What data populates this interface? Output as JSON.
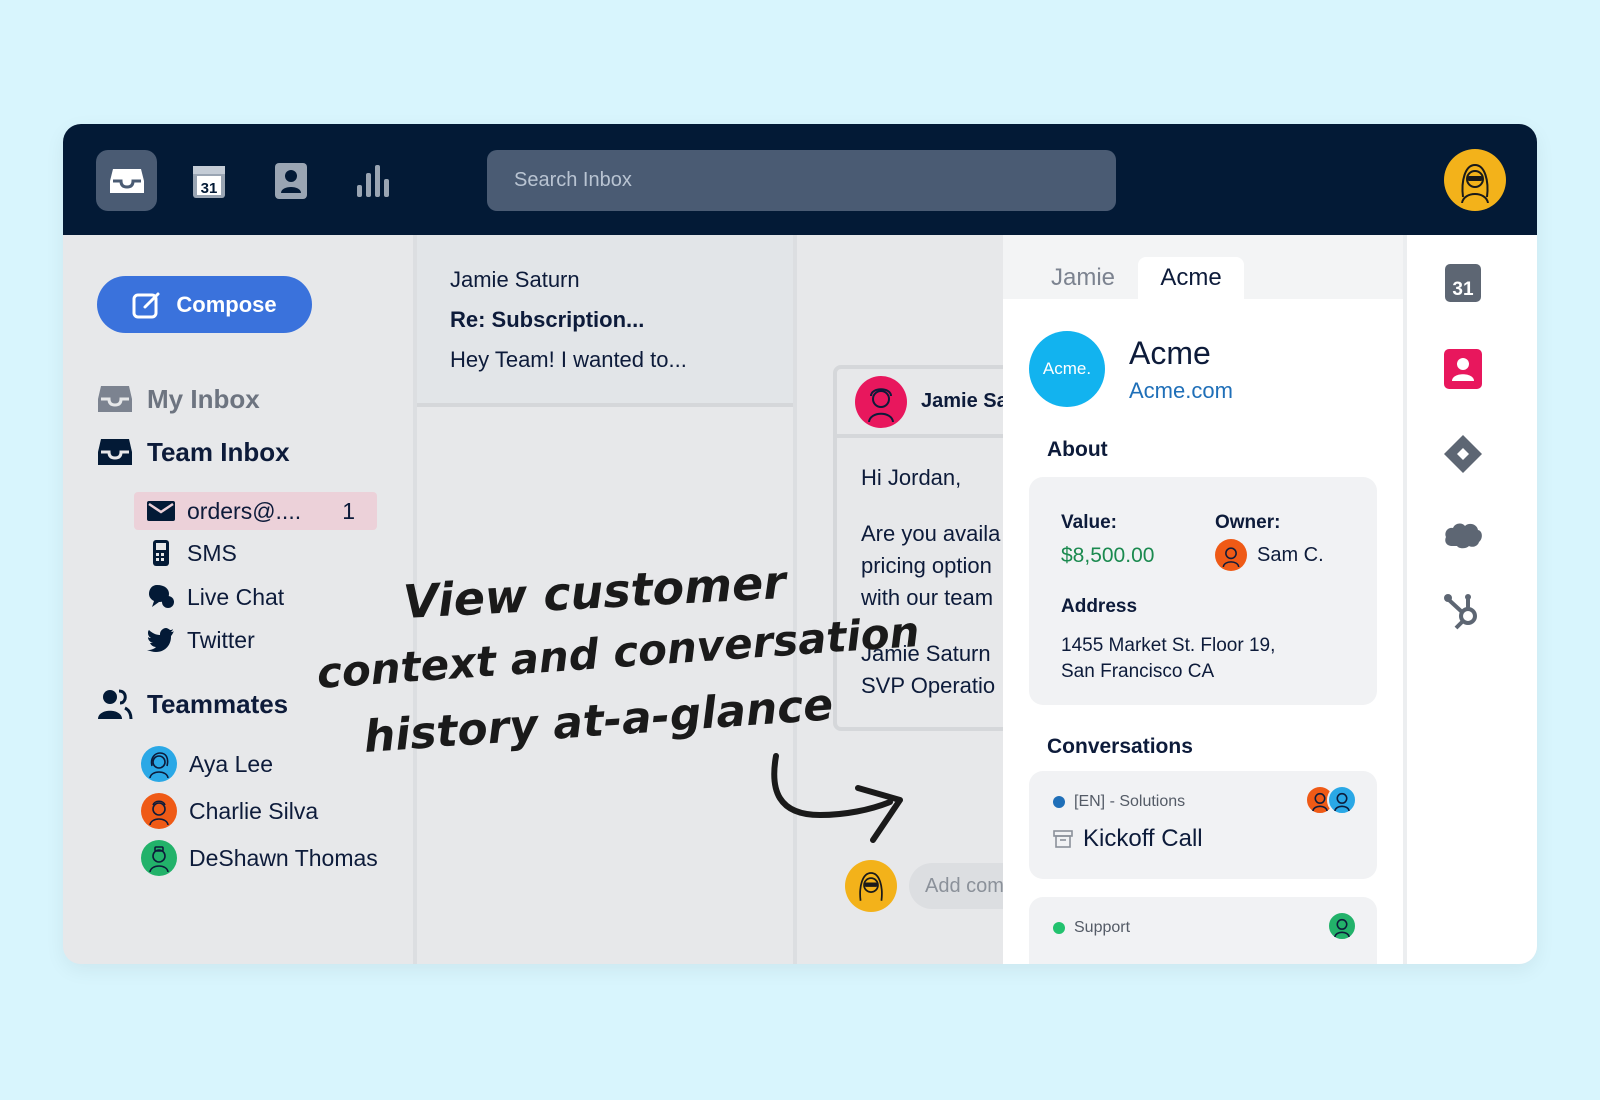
{
  "search": {
    "placeholder": "Search Inbox"
  },
  "calendar_day": "31",
  "sidebar": {
    "compose_label": "Compose",
    "my_inbox": "My Inbox",
    "team_inbox": "Team Inbox",
    "channels": [
      {
        "label": "orders@....",
        "count": "1",
        "icon": "envelope-icon"
      },
      {
        "label": "SMS",
        "icon": "phone-icon"
      },
      {
        "label": "Live Chat",
        "icon": "chat-bubble-icon"
      },
      {
        "label": "Twitter",
        "icon": "twitter-icon"
      }
    ],
    "teammates_label": "Teammates",
    "teammates": [
      {
        "name": "Aya Lee",
        "color": "#2aa8e6"
      },
      {
        "name": "Charlie Silva",
        "color": "#ef5a16"
      },
      {
        "name": "DeShawn Thomas",
        "color": "#22b26a"
      }
    ]
  },
  "message": {
    "from": "Jamie Saturn",
    "subject": "Re: Subscription...",
    "preview": "Hey Team! I wanted to..."
  },
  "conversation": {
    "sender": "Jamie Sa",
    "greeting": "Hi Jordan,",
    "line1": "Are you availa",
    "line2": "pricing option",
    "line3": "with our team",
    "sig_name": "Jamie Saturn",
    "sig_title": "SVP Operatio",
    "comment_placeholder": "Add comm"
  },
  "panel": {
    "tabs": [
      "Jamie",
      "Acme"
    ],
    "active_tab": "Acme",
    "logo_text": "Acme.",
    "company": "Acme",
    "url": "Acme.com",
    "about_title": "About",
    "value_label": "Value:",
    "value": "$8,500.00",
    "owner_label": "Owner:",
    "owner": "Sam C.",
    "address_label": "Address",
    "address_line1": "1455 Market St. Floor 19,",
    "address_line2": "San Francisco CA",
    "conversations_title": "Conversations",
    "conversations": [
      {
        "tag": "[EN] - Solutions",
        "title": "Kickoff Call",
        "dot_color": "#1f6fb8"
      },
      {
        "tag": "Support",
        "title": "",
        "dot_color": "#22c26e"
      }
    ]
  },
  "annotation": {
    "line1": "View customer",
    "line2": "context and conversation",
    "line3": "history at-a-glance"
  },
  "colors": {
    "topbar": "#031a36",
    "accent": "#3a72dc",
    "money": "#1b8a4f",
    "contact_icon": "#e8175d",
    "page_bg": "#d8f5fd"
  }
}
